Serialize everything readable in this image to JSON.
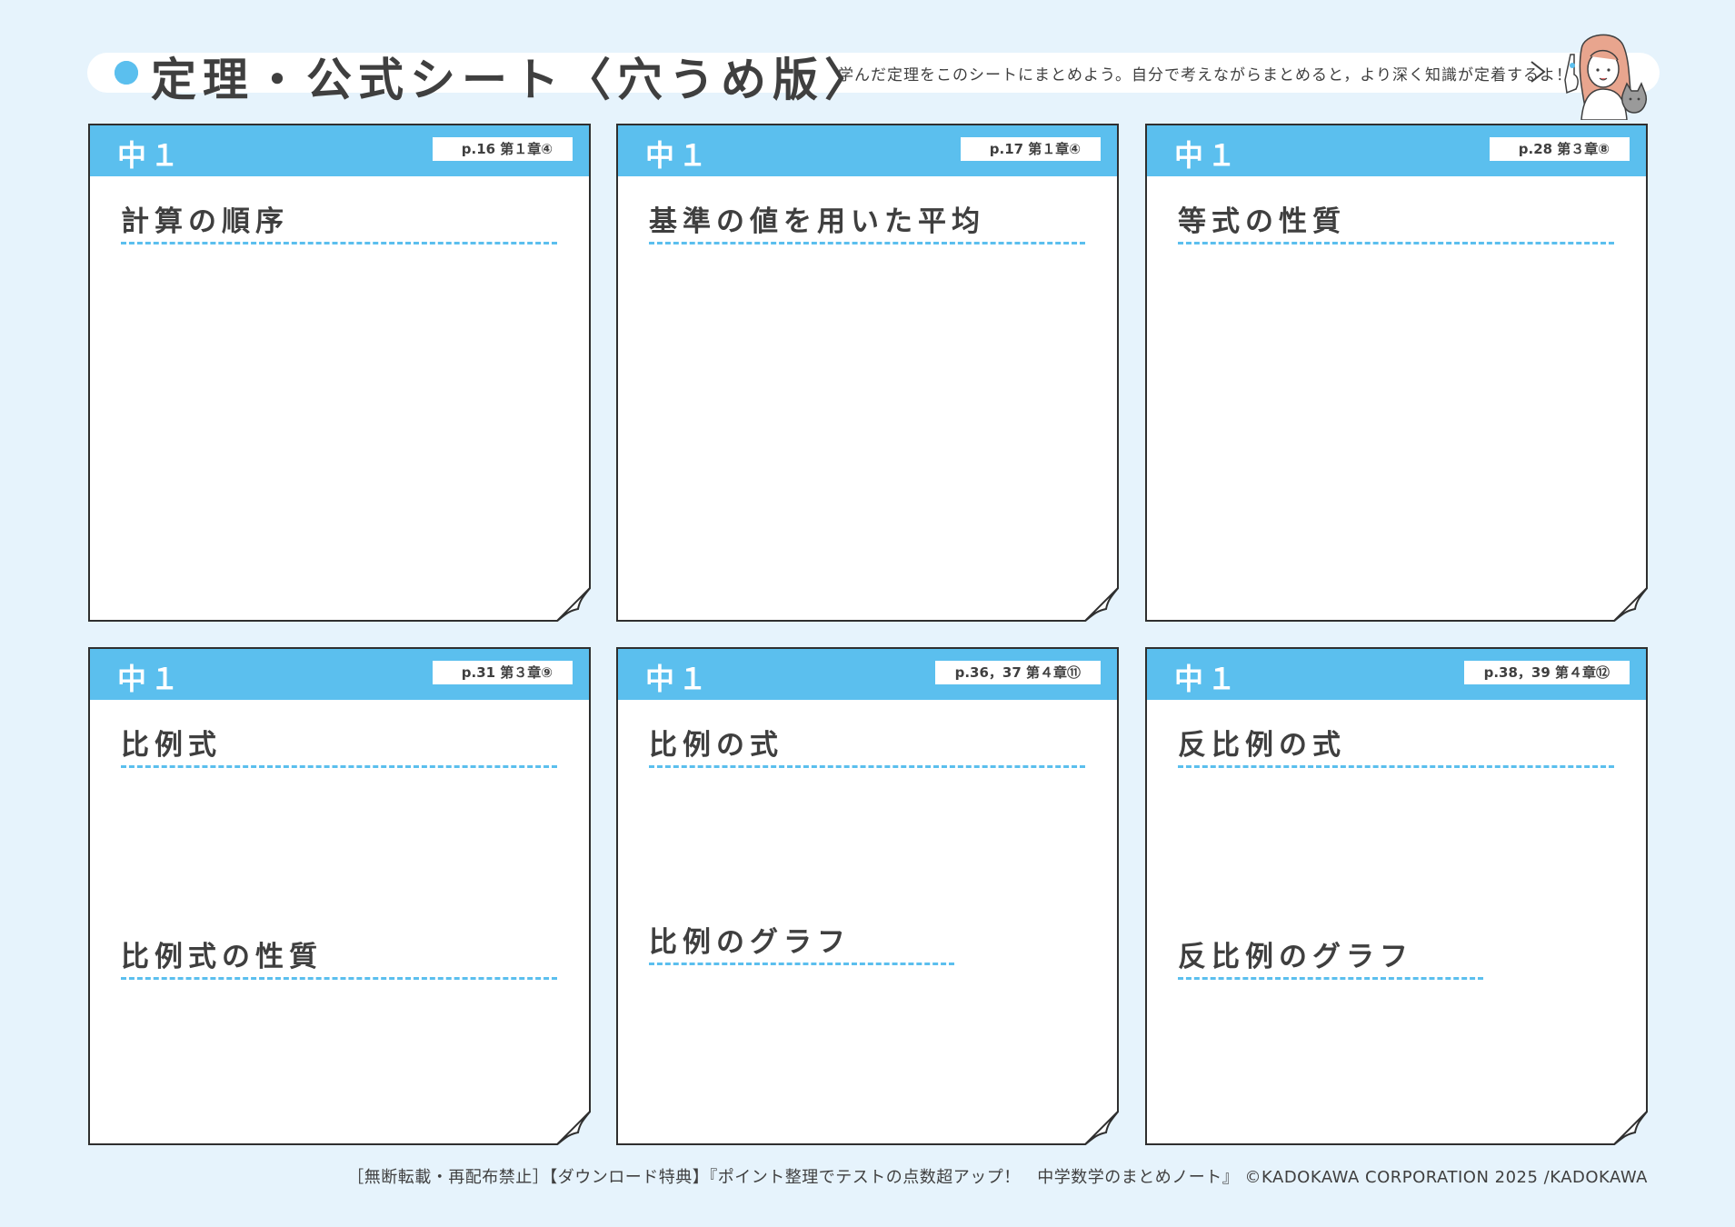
{
  "header": {
    "title": "定理・公式シート〈穴うめ版〉",
    "subtitle": "学んだ定理をこのシートにまとめよう。自分で考えながらまとめると，より深く知識が定着するよ！"
  },
  "cards": [
    {
      "grade": "中１",
      "ref": "p.16 第１章④",
      "topics": [
        "計算の順序"
      ]
    },
    {
      "grade": "中１",
      "ref": "p.17 第１章④",
      "topics": [
        "基準の値を用いた平均"
      ]
    },
    {
      "grade": "中１",
      "ref": "p.28 第３章⑧",
      "topics": [
        "等式の性質"
      ]
    },
    {
      "grade": "中１",
      "ref": "p.31 第３章⑨",
      "topics": [
        "比例式",
        "比例式の性質"
      ]
    },
    {
      "grade": "中１",
      "ref": "p.36，37 第４章⑪",
      "topics": [
        "比例の式",
        "比例のグラフ"
      ]
    },
    {
      "grade": "中１",
      "ref": "p.38，39 第４章⑫",
      "topics": [
        "反比例の式",
        "反比例のグラフ"
      ]
    }
  ],
  "footer": {
    "text": "［無断転載・再配布禁止］【ダウンロード特典】『ポイント整理でテストの点数超アップ！　中学数学のまとめノート』 ©KADOKAWA CORPORATION 2025 /KADOKAWA"
  },
  "colors": {
    "accent": "#5bbfee",
    "background": "#e6f3fc",
    "text": "#3f3f3f"
  },
  "icons": [
    "bullet-dot-icon",
    "chevron-right-icon",
    "girl-with-cat-illustration",
    "page-curl-icon"
  ]
}
